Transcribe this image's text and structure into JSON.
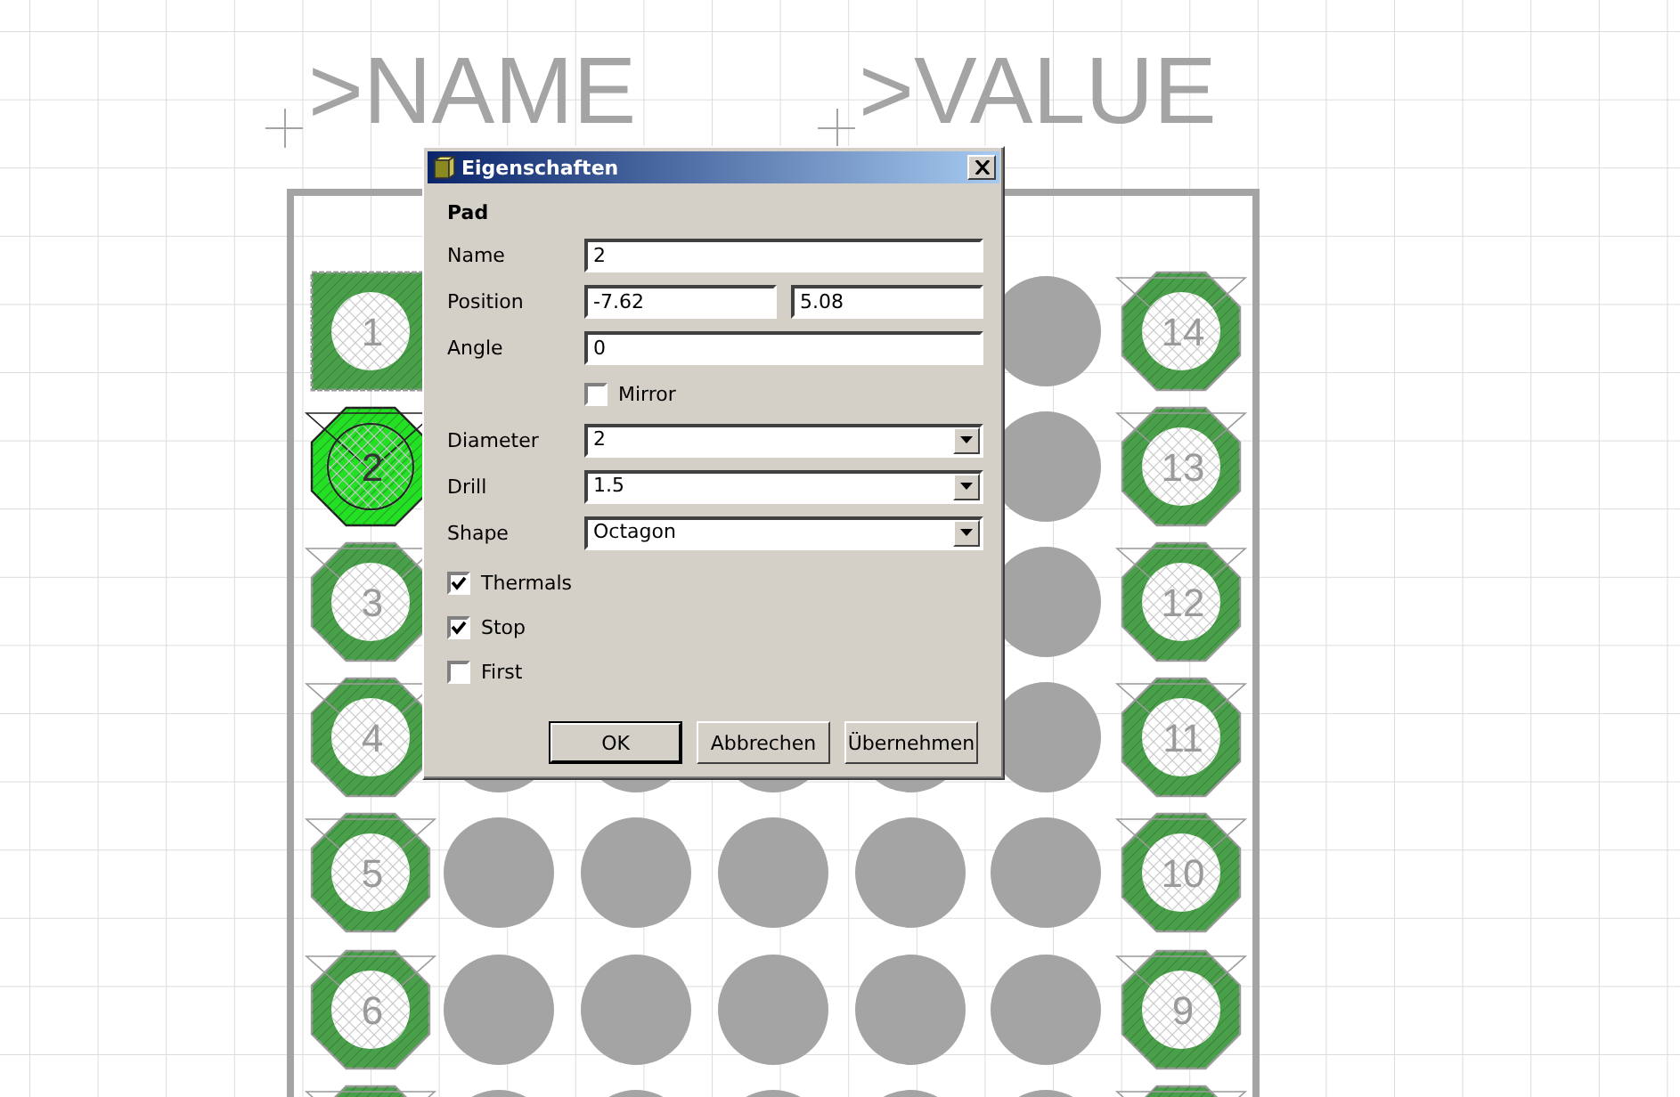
{
  "canvas": {
    "name_label": ">NAME",
    "value_label": ">VALUE",
    "left_pads": [
      {
        "label": "1",
        "kind": "square",
        "selected": false
      },
      {
        "label": "2",
        "kind": "octagon",
        "selected": true
      },
      {
        "label": "3",
        "kind": "octagon",
        "selected": false
      },
      {
        "label": "4",
        "kind": "octagon",
        "selected": false
      },
      {
        "label": "5",
        "kind": "octagon",
        "selected": false
      },
      {
        "label": "6",
        "kind": "octagon",
        "selected": false
      }
    ],
    "right_pads": [
      {
        "label": "14",
        "kind": "octagon",
        "selected": false
      },
      {
        "label": "13",
        "kind": "octagon",
        "selected": false
      },
      {
        "label": "12",
        "kind": "octagon",
        "selected": false
      },
      {
        "label": "11",
        "kind": "octagon",
        "selected": false
      },
      {
        "label": "10",
        "kind": "octagon",
        "selected": false
      },
      {
        "label": "9",
        "kind": "octagon",
        "selected": false
      }
    ]
  },
  "dialog": {
    "title": "Eigenschaften",
    "section": "Pad",
    "fields": [
      {
        "kind": "text",
        "label": "Name",
        "values": [
          "2"
        ]
      },
      {
        "kind": "pair",
        "label": "Position",
        "values": [
          "-7.62",
          "5.08"
        ]
      },
      {
        "kind": "text",
        "label": "Angle",
        "values": [
          "0"
        ]
      },
      {
        "kind": "checkbox",
        "label": "Mirror",
        "checked": false
      },
      {
        "kind": "combo",
        "label": "Diameter",
        "values": [
          "2"
        ]
      },
      {
        "kind": "combo",
        "label": "Drill",
        "values": [
          "1.5"
        ]
      },
      {
        "kind": "combo",
        "label": "Shape",
        "values": [
          "Octagon"
        ]
      }
    ],
    "options": [
      {
        "label": "Thermals",
        "checked": true
      },
      {
        "label": "Stop",
        "checked": true
      },
      {
        "label": "First",
        "checked": false
      }
    ],
    "buttons": [
      {
        "label": "OK",
        "default": true
      },
      {
        "label": "Abbrechen",
        "default": false
      },
      {
        "label": "Übernehmen",
        "default": false
      }
    ]
  }
}
